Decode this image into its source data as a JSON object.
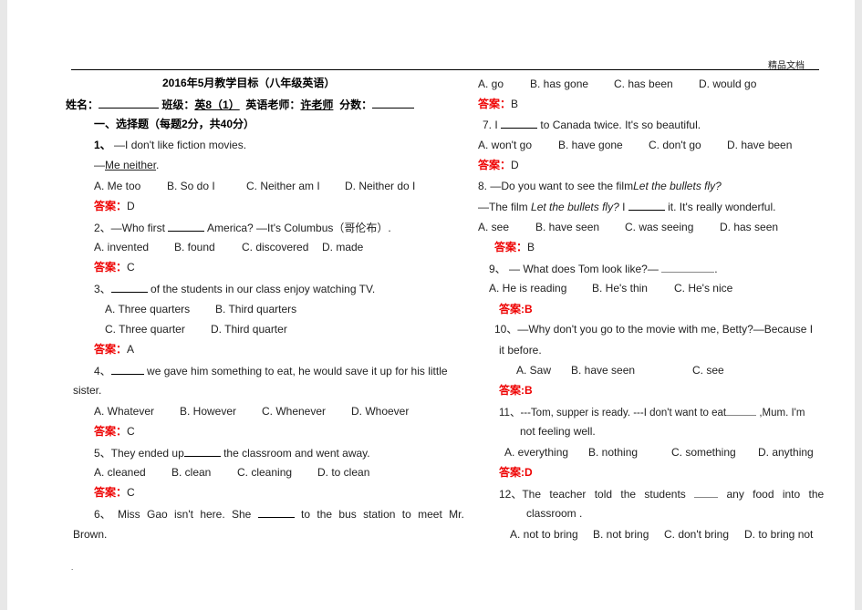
{
  "header": {
    "brand": "精品文档"
  },
  "title": "2016年5月教学目标（八年级英语）",
  "info": {
    "name_label": "姓名：",
    "class_label": "班级：",
    "class_value": "英8（1）",
    "teacher_label": "英语老师：",
    "teacher_value": "许老师",
    "score_label": "分数："
  },
  "section": "一、选择题（每题2分，共40分）",
  "answer_label": "答案：",
  "q1": {
    "num": "1、",
    "text": "—I don't like fiction movies.",
    "reply_dash": "—",
    "reply": "Me neither",
    "reply_end": ".",
    "opts": [
      "A. Me too",
      "B. So do I",
      "C. Neither am I",
      "D. Neither do I"
    ],
    "ans": "D"
  },
  "q2": {
    "text1": "2、—Who first",
    "text2": "America? —It's Columbus（哥伦布）.",
    "opts": [
      "A. invented",
      "B. found",
      "C. discovered",
      "D. made"
    ],
    "ans": "C"
  },
  "q3": {
    "num": "3、",
    "text": "of the students in our class enjoy watching TV.",
    "opts": [
      "A. Three quarters",
      "B. Third quarters",
      "C. Three quarter",
      "D. Third quarter"
    ],
    "ans": "A"
  },
  "q4": {
    "num": "4、",
    "text": "we gave him something to eat, he would save it up for his little",
    "cont": "sister.",
    "opts": [
      "A. Whatever",
      "B. However",
      "C. Whenever",
      "D. Whoever"
    ],
    "ans": "C"
  },
  "q5": {
    "text1": "5、They ended up",
    "text2": "the classroom and went away.",
    "opts": [
      "A. cleaned",
      "B. clean",
      "C. cleaning",
      "D. to clean"
    ],
    "ans": "C"
  },
  "q6": {
    "text1": "6、 Miss Gao isn't here. She",
    "text2": "to the bus station to meet Mr.",
    "cont": "Brown.",
    "opts": [
      "A. go",
      "B. has gone",
      "C. has been",
      "D. would go"
    ],
    "ans": "B"
  },
  "q7": {
    "text1": "7. I",
    "text2": "to Canada twice. It's so beautiful.",
    "opts": [
      "A. won't go",
      "B. have gone",
      "C. don't go",
      "D. have been"
    ],
    "ans": "D"
  },
  "q8": {
    "text1": "8. —Do you want to see the film",
    "film": "Let the bullets fly?",
    "text2": "—The film",
    "text3": "I",
    "text4": "it. It's really wonderful.",
    "opts": [
      "A. see",
      "B. have seen",
      "C. was seeing",
      "D. has seen"
    ],
    "ans": "B"
  },
  "q9": {
    "text": "9、 — What does Tom look like?—",
    "end": ".",
    "opts": [
      "A. He is reading",
      "B. He's thin",
      "C. He's nice"
    ],
    "ans": "答案:B"
  },
  "q10": {
    "text": "10、—Why don't you go to the movie with me, Betty?—Because I",
    "cont": "it before.",
    "opts": [
      "A. Saw",
      "B. have seen",
      "C. see"
    ],
    "ans": "答案:B"
  },
  "q11": {
    "text1": "11、---Tom, supper is ready. ---I don't want to eat",
    "text2": ",Mum. I'm",
    "cont": "not feeling well.",
    "opts": [
      "A. everything",
      "B. nothing",
      "C. something",
      "D. anything"
    ],
    "ans": "答案:D"
  },
  "q12": {
    "text1": "12、The teacher told the students",
    "text2": "any food into the",
    "cont": "classroom .",
    "opts": [
      "A. not to bring",
      "B. not bring",
      "C. don't bring",
      "D. to bring not"
    ]
  },
  "footer_dot": "."
}
